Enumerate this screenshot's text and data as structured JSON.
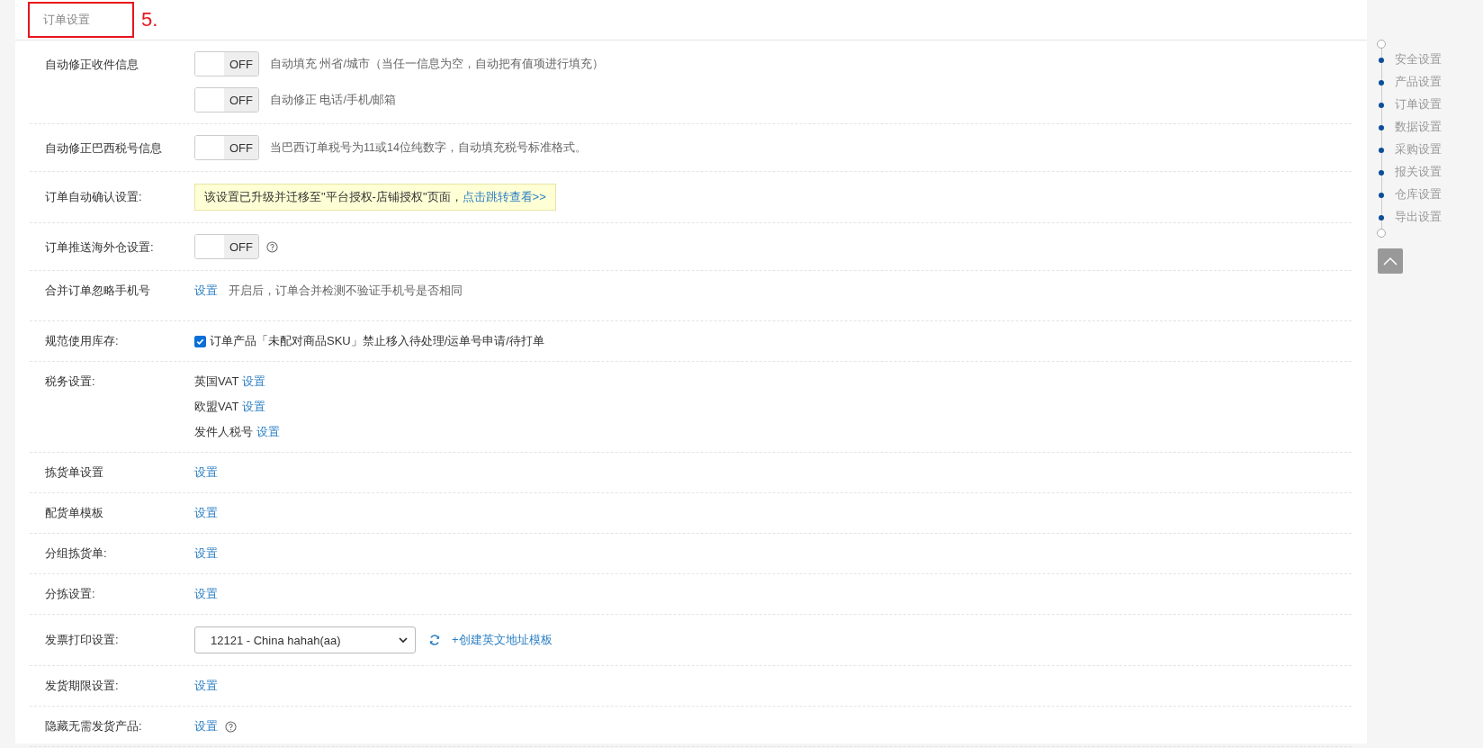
{
  "section": {
    "title": "订单设置",
    "annotation": "5."
  },
  "rows": [
    {
      "label": "自动修正收件信息",
      "kind": "toggles",
      "items": [
        {
          "on": false,
          "text": "OFF",
          "description": "自动填充 州省/城市（当任一信息为空，自动把有值项进行填充）"
        },
        {
          "on": false,
          "text": "OFF",
          "description": "自动修正 电话/手机/邮箱"
        }
      ]
    },
    {
      "label": "自动修正巴西税号信息",
      "kind": "toggles",
      "items": [
        {
          "on": false,
          "text": "OFF",
          "description": "当巴西订单税号为11或14位纯数字，自动填充税号标准格式。"
        }
      ]
    },
    {
      "label": "订单自动确认设置:",
      "kind": "notice",
      "text": "该设置已升级并迁移至\"平台授权-店铺授权\"页面，",
      "link": "点击跳转查看>>"
    },
    {
      "label": "订单推送海外仓设置:",
      "kind": "toggles",
      "help": true,
      "items": [
        {
          "on": false,
          "text": "OFF"
        }
      ]
    },
    {
      "label": "合并订单忽略手机号",
      "kind": "link",
      "link": "设置",
      "description": "开启后，订单合并检测不验证手机号是否相同"
    },
    {
      "label": "规范使用库存:",
      "kind": "checkbox",
      "checked": true,
      "text": "订单产品「未配对商品SKU」禁止移入待处理/运单号申请/待打单"
    },
    {
      "label": "税务设置:",
      "kind": "lines",
      "items": [
        {
          "text": "英国VAT",
          "link": "设置"
        },
        {
          "text": "欧盟VAT",
          "link": "设置"
        },
        {
          "text": "发件人税号",
          "link": "设置"
        }
      ]
    },
    {
      "label": "拣货单设置",
      "kind": "link",
      "link": "设置"
    },
    {
      "label": "配货单模板",
      "kind": "link",
      "link": "设置"
    },
    {
      "label": "分组拣货单:",
      "kind": "link",
      "link": "设置"
    },
    {
      "label": "分拣设置:",
      "kind": "link",
      "link": "设置"
    },
    {
      "label": "发票打印设置:",
      "kind": "select",
      "value": "12121 - China hahah(aa)",
      "link": "+创建英文地址模板"
    },
    {
      "label": "发货期限设置:",
      "kind": "link",
      "link": "设置"
    },
    {
      "label": "隐藏无需发货产品:",
      "kind": "link",
      "link": "设置",
      "help": true
    }
  ],
  "nav": [
    {
      "label": "安全设置"
    },
    {
      "label": "产品设置"
    },
    {
      "label": "订单设置"
    },
    {
      "label": "数据设置"
    },
    {
      "label": "采购设置"
    },
    {
      "label": "报关设置"
    },
    {
      "label": "仓库设置"
    },
    {
      "label": "导出设置"
    }
  ]
}
